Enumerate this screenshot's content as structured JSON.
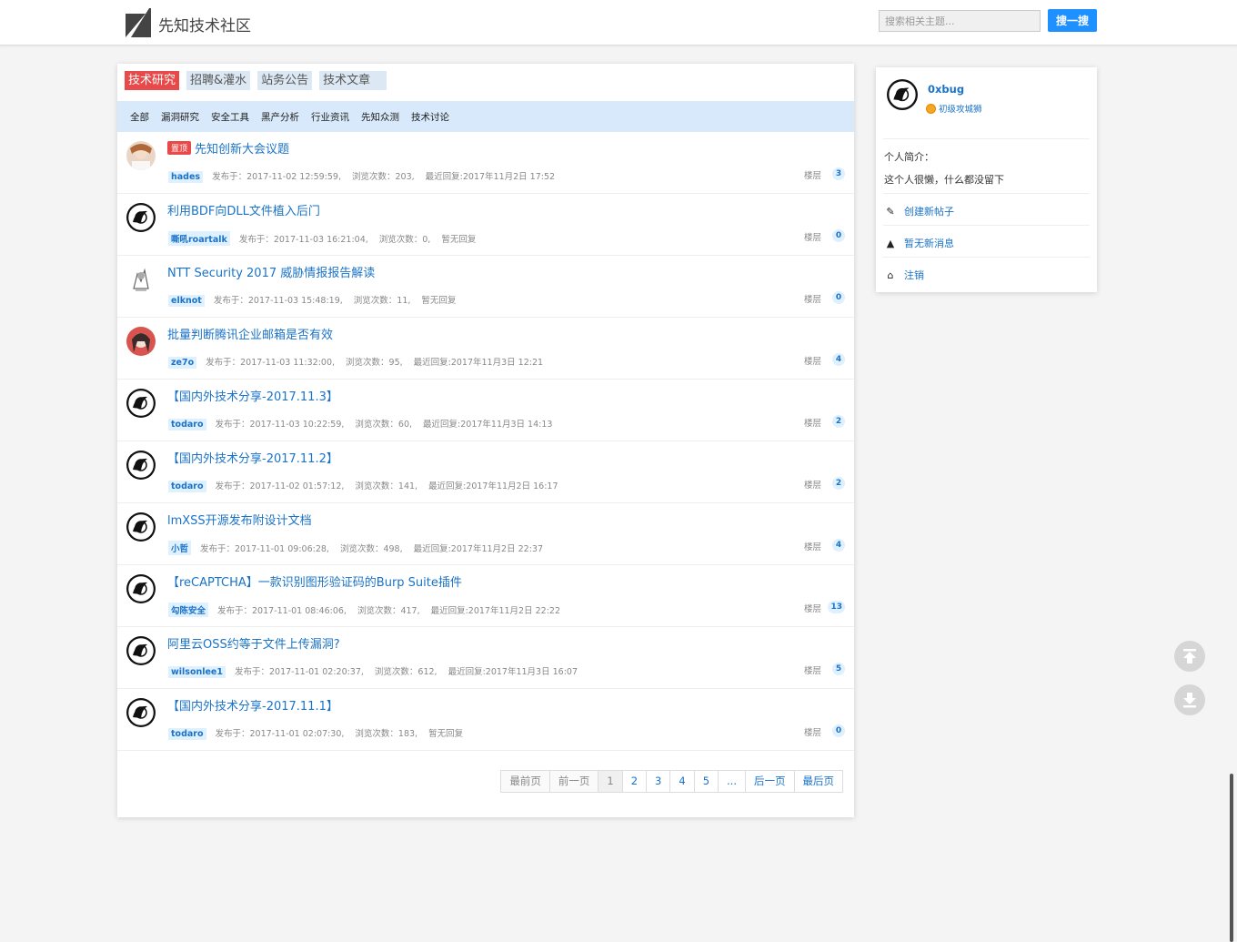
{
  "header": {
    "site_title": "先知技术社区",
    "search_placeholder": "搜索相关主题...",
    "search_button": "搜一搜"
  },
  "tabs": [
    {
      "label": "技术研究",
      "active": true
    },
    {
      "label": "招聘&灌水",
      "active": false
    },
    {
      "label": "站务公告",
      "active": false
    },
    {
      "label": "技术文章",
      "active": false
    }
  ],
  "subnav": [
    "全部",
    "漏洞研究",
    "安全工具",
    "黑产分析",
    "行业资讯",
    "先知众测",
    "技术讨论"
  ],
  "topics": [
    {
      "pinned": true,
      "pin_label": "置顶",
      "title": "先知创新大会议题",
      "author": "hades",
      "posted": "发布于：2017-11-02 12:59:59,",
      "views": "浏览次数：203,",
      "last_reply": "最近回复:2017年11月2日 17:52",
      "floor_label": "楼层",
      "floors": "3",
      "avatar": "photo"
    },
    {
      "pinned": false,
      "title": "利用BDF向DLL文件植入后门",
      "author": "嘶吼roartalk",
      "posted": "发布于：2017-11-03 16:21:04,",
      "views": "浏览次数：0,",
      "last_reply": "暂无回复",
      "floor_label": "楼层",
      "floors": "0",
      "avatar": "default"
    },
    {
      "pinned": false,
      "title": "NTT Security 2017 威胁情报报告解读",
      "author": "elknot",
      "posted": "发布于：2017-11-03 15:48:19,",
      "views": "浏览次数：11,",
      "last_reply": "暂无回复",
      "floor_label": "楼层",
      "floors": "0",
      "avatar": "sketch"
    },
    {
      "pinned": false,
      "title": "批量判断腾讯企业邮箱是否有效",
      "author": "ze7o",
      "posted": "发布于：2017-11-03 11:32:00,",
      "views": "浏览次数：95,",
      "last_reply": "最近回复:2017年11月3日 12:21",
      "floor_label": "楼层",
      "floors": "4",
      "avatar": "anime"
    },
    {
      "pinned": false,
      "title": "【国内外技术分享-2017.11.3】",
      "author": "todaro",
      "posted": "发布于：2017-11-03 10:22:59,",
      "views": "浏览次数：60,",
      "last_reply": "最近回复:2017年11月3日 14:13",
      "floor_label": "楼层",
      "floors": "2",
      "avatar": "default"
    },
    {
      "pinned": false,
      "title": "【国内外技术分享-2017.11.2】",
      "author": "todaro",
      "posted": "发布于：2017-11-02 01:57:12,",
      "views": "浏览次数：141,",
      "last_reply": "最近回复:2017年11月2日 16:17",
      "floor_label": "楼层",
      "floors": "2",
      "avatar": "default"
    },
    {
      "pinned": false,
      "title": "lmXSS开源发布附设计文档",
      "author": "小哲",
      "posted": "发布于：2017-11-01 09:06:28,",
      "views": "浏览次数：498,",
      "last_reply": "最近回复:2017年11月2日 22:37",
      "floor_label": "楼层",
      "floors": "4",
      "avatar": "default"
    },
    {
      "pinned": false,
      "title": "【reCAPTCHA】一款识别图形验证码的Burp Suite插件",
      "author": "勾陈安全",
      "posted": "发布于：2017-11-01 08:46:06,",
      "views": "浏览次数：417,",
      "last_reply": "最近回复:2017年11月2日 22:22",
      "floor_label": "楼层",
      "floors": "13",
      "avatar": "default"
    },
    {
      "pinned": false,
      "title": "阿里云OSS约等于文件上传漏洞?",
      "author": "wilsonlee1",
      "posted": "发布于：2017-11-01 02:20:37,",
      "views": "浏览次数：612,",
      "last_reply": "最近回复:2017年11月3日 16:07",
      "floor_label": "楼层",
      "floors": "5",
      "avatar": "default"
    },
    {
      "pinned": false,
      "title": "【国内外技术分享-2017.11.1】",
      "author": "todaro",
      "posted": "发布于：2017-11-01 02:07:30,",
      "views": "浏览次数：183,",
      "last_reply": "暂无回复",
      "floor_label": "楼层",
      "floors": "0",
      "avatar": "default"
    }
  ],
  "pagination": [
    "最前页",
    "前一页",
    "1",
    "2",
    "3",
    "4",
    "5",
    "...",
    "后一页",
    "最后页"
  ],
  "sidebar": {
    "username": "0xbug",
    "rank": "初级攻城狮",
    "bio_label": "个人简介：",
    "bio_text": "这个人很懒，什么都没留下",
    "links": [
      {
        "icon": "pencil-icon",
        "label": "创建新帖子"
      },
      {
        "icon": "bell-icon",
        "label": "暂无新消息"
      },
      {
        "icon": "home-icon",
        "label": "注销"
      }
    ]
  }
}
